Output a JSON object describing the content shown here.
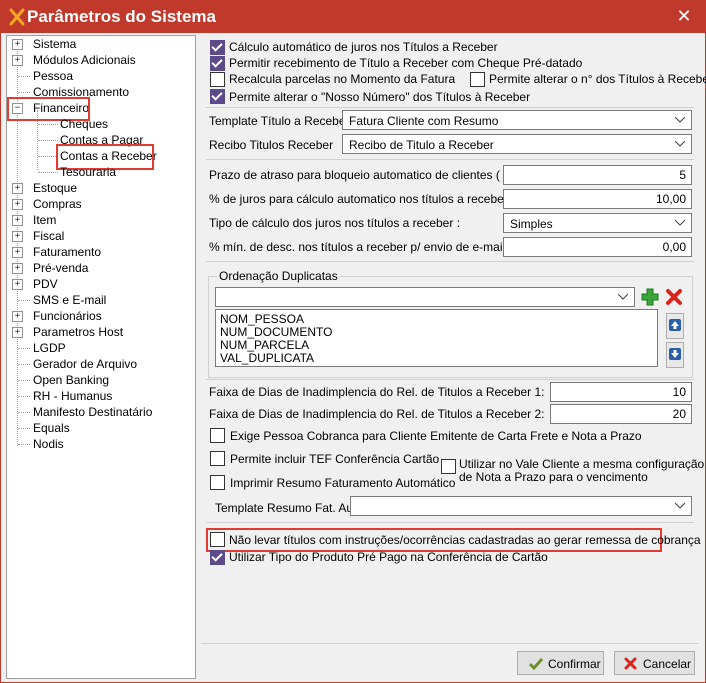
{
  "window": {
    "title": "Parâmetros do Sistema"
  },
  "tree": {
    "items": [
      {
        "label": "Sistema"
      },
      {
        "label": "Módulos Adicionais"
      },
      {
        "label": "Pessoa"
      },
      {
        "label": "Comissionamento"
      },
      {
        "label": "Financeiro"
      },
      {
        "label": "Cheques"
      },
      {
        "label": "Contas a Pagar"
      },
      {
        "label": "Contas a Receber"
      },
      {
        "label": "Tesouraria"
      },
      {
        "label": "Estoque"
      },
      {
        "label": "Compras"
      },
      {
        "label": "Item"
      },
      {
        "label": "Fiscal"
      },
      {
        "label": "Faturamento"
      },
      {
        "label": "Pré-venda"
      },
      {
        "label": "PDV"
      },
      {
        "label": "SMS e E-mail"
      },
      {
        "label": "Funcionários"
      },
      {
        "label": "Parametros Host"
      },
      {
        "label": "LGDP"
      },
      {
        "label": "Gerador de Arquivo"
      },
      {
        "label": "Open Banking"
      },
      {
        "label": "RH - Humanus"
      },
      {
        "label": "Manifesto Destinatário"
      },
      {
        "label": "Equals"
      },
      {
        "label": "Nodis"
      }
    ]
  },
  "options": {
    "calc_juros": "Cálculo automático de juros nos Títulos a Receber",
    "permitir_cheque": "Permitir recebimento de Título a Receber com Cheque Pré-datado",
    "recalcula": "Recalcula parcelas no Momento da Fatura",
    "alterar_numero": "Permite alterar o n° dos Títulos à Receber",
    "nosso_numero": "Permite alterar o \"Nosso Número\" dos Títulos à Receber"
  },
  "templates": {
    "template_label": "Template Título a Receber:",
    "template_value": "Fatura Cliente com Resumo",
    "recibo_label": "Recibo Titulos Receber",
    "recibo_value": "Recibo de Titulo a Receber"
  },
  "params": {
    "prazo_label": "Prazo de atraso para bloqueio automatico de clientes ( dias ) :",
    "prazo_value": "5",
    "juros_label": "% de juros para cálculo automatico nos títulos a receber :",
    "juros_value": "10,00",
    "tipo_label": "Tipo de cálculo dos juros nos títulos a receber :",
    "tipo_value": "Simples",
    "desc_label": "% mín. de desc. nos títulos a receber p/ envio de e-mail :",
    "desc_value": "0,00"
  },
  "ordenacao": {
    "title": "Ordenação Duplicatas",
    "combo_value": "",
    "items": [
      "NOM_PESSOA",
      "NUM_DOCUMENTO",
      "NUM_PARCELA",
      "VAL_DUPLICATA"
    ]
  },
  "faixa": {
    "faixa1_label": "Faixa de Dias de Inadimplencia do Rel. de Titulos a Receber 1:",
    "faixa1_value": "10",
    "faixa2_label": "Faixa de Dias de Inadimplencia do Rel. de Titulos a Receber 2:",
    "faixa2_value": "20"
  },
  "options2": {
    "exige_pessoa": "Exige Pessoa Cobranca para Cliente Emitente de Carta Frete e Nota a Prazo",
    "tef": "Permite incluir TEF Conferência Cartão",
    "vale_cliente_1": "Utilizar no Vale Cliente a mesma configuração",
    "vale_cliente_2": "de Nota a Prazo para o vencimento",
    "imprimir_resumo": "Imprimir Resumo Faturamento Automático",
    "template_resumo_label": "Template Resumo Fat. Aut.:",
    "template_resumo_value": "",
    "nao_levar": "Não levar títulos com instruções/ocorrências cadastradas ao gerar remessa de cobrança",
    "pre_pago": "Utilizar Tipo do Produto Pré Pago na Conferência de Cartão"
  },
  "buttons": {
    "confirm": "Confirmar",
    "cancel": "Cancelar"
  },
  "colors": {
    "titlebar": "#c0392b",
    "highlight": "#e03c31",
    "check": "#5c4a8a"
  }
}
